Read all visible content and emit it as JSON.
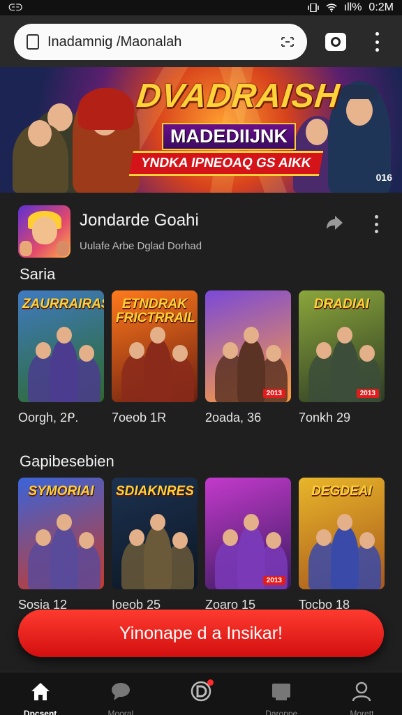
{
  "status_bar": {
    "left": "ᕮᕭ",
    "signal": "ıll%",
    "time": "0:2M"
  },
  "browser": {
    "url": "Inadamnig /Maonalah"
  },
  "banner": {
    "title": "DVADRAISH",
    "subtitle": "MADEDIIJNK",
    "tagline": "YNDKA IPNEOAQ GS AIKK",
    "age": "016"
  },
  "app": {
    "name": "Jondarde Goahi",
    "description": "Uulafe Arbe Dglad Dorhad"
  },
  "sections": [
    {
      "title": "Saria",
      "cards": [
        {
          "logo": "ZAURRAIRAS",
          "caption": "Oorgh,  2ᑭ.",
          "colors": [
            "#3f7ac2",
            "#2d6a2a"
          ],
          "fig": "#4b3c8f"
        },
        {
          "logo": "ETNDRAK FRICTRRAIL",
          "caption": "7oeob   1R",
          "colors": [
            "#ff7a1c",
            "#6b1d10"
          ],
          "fig": "#8a2a1b"
        },
        {
          "logo": "",
          "caption": "2oada,   36",
          "colors": [
            "#7a49d8",
            "#ff9e3d"
          ],
          "fig": "#5a3324",
          "badge": "2013"
        },
        {
          "logo": "DRADIAI",
          "caption": "7onkh   29",
          "colors": [
            "#8aa63b",
            "#2d3b24"
          ],
          "fig": "#3c4e3a",
          "badge": "2013"
        }
      ]
    },
    {
      "title": "Gapibesebien",
      "cards": [
        {
          "logo": "SYMORIAI",
          "caption": "Sosia    12",
          "colors": [
            "#3a64d8",
            "#c83a2a"
          ],
          "fig": "#5a4a9a"
        },
        {
          "logo": "SDIAKNRES",
          "caption": "Ioeob    25",
          "colors": [
            "#1c3250",
            "#0c1624"
          ],
          "fig": "#6a5a3a"
        },
        {
          "logo": "",
          "caption": "Zoaro    15",
          "colors": [
            "#c33acb",
            "#3a1b60"
          ],
          "fig": "#7a3ab8",
          "badge": "2013"
        },
        {
          "logo": "DEGDEAI",
          "caption": "Tocbo   18",
          "colors": [
            "#e8b62a",
            "#a7571c"
          ],
          "fig": "#3a4aa8"
        }
      ]
    }
  ],
  "cta": {
    "label": "Yinonape d a Insikar!"
  },
  "nav": [
    {
      "label": "Dpcsent",
      "icon": "home-icon",
      "active": true
    },
    {
      "label": "Mooral",
      "icon": "chat-icon",
      "active": false
    },
    {
      "label": "",
      "icon": "notification-center-icon",
      "active": false
    },
    {
      "label": "Daroppe",
      "icon": "library-icon",
      "active": false
    },
    {
      "label": "Morett",
      "icon": "profile-icon",
      "active": false
    }
  ],
  "colors": {
    "accent": "#e21b1b",
    "background": "#1f1f20"
  }
}
